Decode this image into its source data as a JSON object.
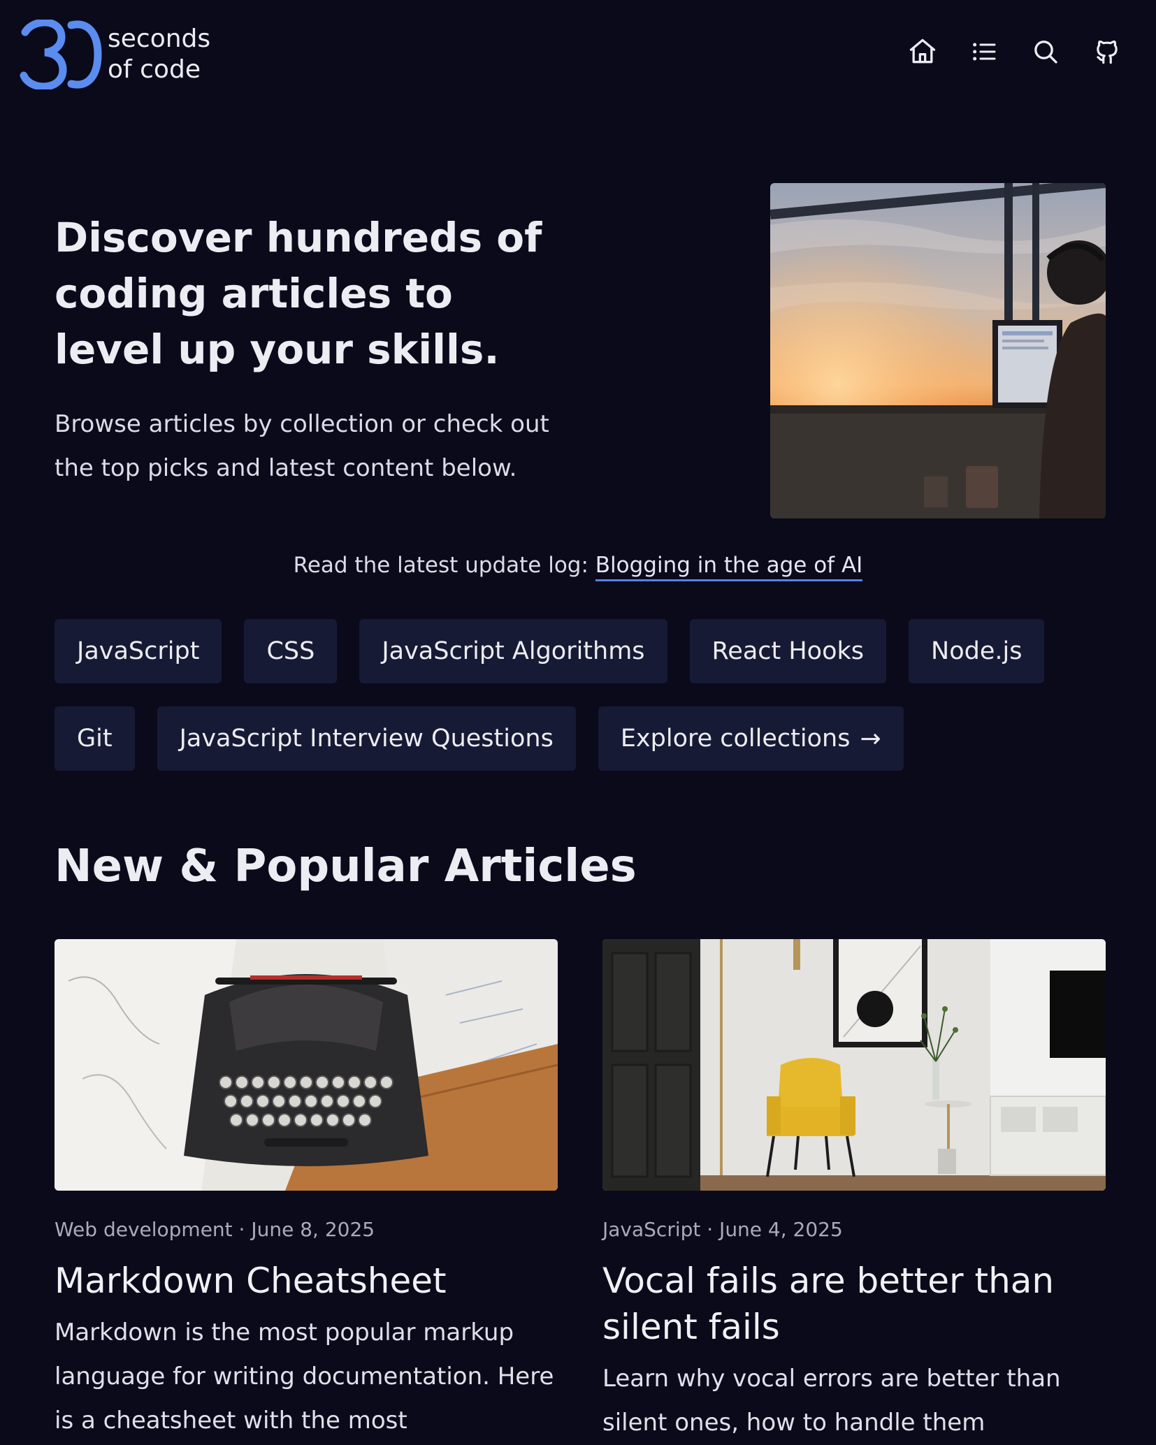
{
  "brand": {
    "name_line1": "seconds",
    "name_line2": "of code",
    "accent": "#5b8cf0"
  },
  "nav": [
    {
      "icon": "home-icon",
      "label": "Home"
    },
    {
      "icon": "list-icon",
      "label": "Collections"
    },
    {
      "icon": "search-icon",
      "label": "Search"
    },
    {
      "icon": "github-icon",
      "label": "GitHub"
    }
  ],
  "hero": {
    "title": "Discover hundreds of coding articles to level up your skills.",
    "subtitle": "Browse articles by collection or check out the top picks and latest content below."
  },
  "update_log": {
    "prefix": "Read the latest update log: ",
    "link_text": "Blogging in the age of AI"
  },
  "collections": {
    "chips": [
      "JavaScript",
      "CSS",
      "JavaScript Algorithms",
      "React Hooks",
      "Node.js",
      "Git",
      "JavaScript Interview Questions"
    ],
    "explore_label": "Explore collections",
    "explore_arrow": "→"
  },
  "articles_section": {
    "title": "New & Popular Articles",
    "cards": [
      {
        "meta": "Web development · June 8, 2025",
        "title": "Markdown Cheatsheet",
        "description": "Markdown is the most popular markup language for writing documentation. Here is a cheatsheet with the most"
      },
      {
        "meta": "JavaScript · June 4, 2025",
        "title": "Vocal fails are better than silent fails",
        "description": "Learn why vocal errors are better than silent ones, how to handle them"
      }
    ]
  },
  "colors": {
    "background": "#0a0a1b",
    "chip_bg": "#171a34",
    "text": "#ececf2",
    "muted": "#a9abbd",
    "link_underline": "#5b7fe6"
  }
}
